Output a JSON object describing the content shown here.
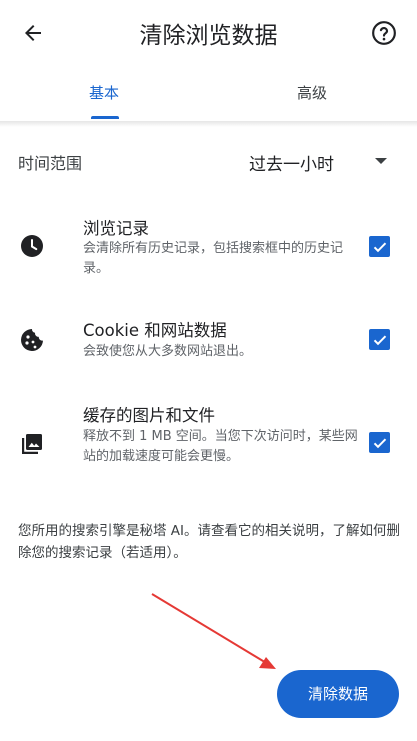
{
  "header": {
    "title": "清除浏览数据",
    "back_icon": "arrow-back-icon",
    "help_icon": "help-icon"
  },
  "tabs": [
    {
      "label": "基本",
      "selected": true
    },
    {
      "label": "高级",
      "selected": false
    }
  ],
  "time_range": {
    "label": "时间范围",
    "value": "过去一小时"
  },
  "options": [
    {
      "title": "浏览记录",
      "description": "会清除所有历史记录，包括搜索框中的历史记录。",
      "icon": "clock-icon",
      "checked": true
    },
    {
      "title": "Cookie 和网站数据",
      "description": "会致使您从大多数网站退出。",
      "icon": "cookie-icon",
      "checked": true
    },
    {
      "title": "缓存的图片和文件",
      "description": "释放不到 1 MB 空间。当您下次访问时，某些网站的加载速度可能会更慢。",
      "icon": "image-icon",
      "checked": true
    }
  ],
  "footer_note": "您所用的搜索引擎是秘塔 AI。请查看它的相关说明，了解如何删除您的搜索记录（若适用）。",
  "clear_button": "清除数据",
  "colors": {
    "accent": "#1a66cf",
    "annotation_arrow": "#e53935"
  }
}
